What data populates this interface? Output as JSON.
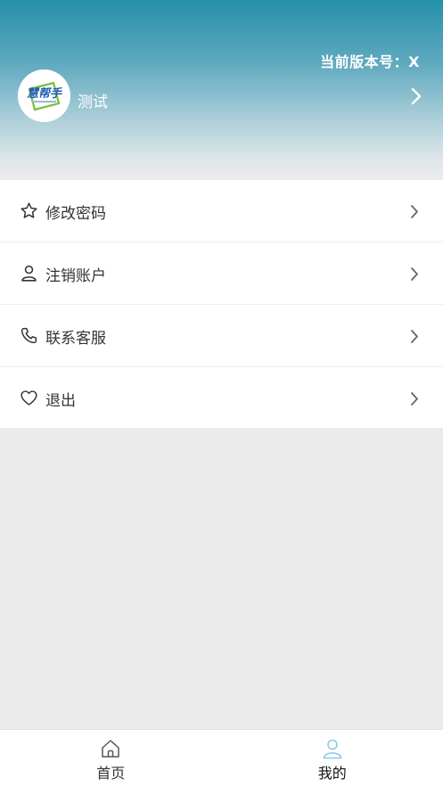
{
  "header": {
    "version_text": "当前版本号：X",
    "avatar_logo_text": "慧帮手",
    "username": "测试"
  },
  "menu": {
    "items": [
      {
        "label": "修改密码",
        "icon": "star-icon"
      },
      {
        "label": "注销账户",
        "icon": "user-icon"
      },
      {
        "label": "联系客服",
        "icon": "phone-icon"
      },
      {
        "label": "退出",
        "icon": "heart-icon"
      }
    ]
  },
  "tabbar": {
    "tabs": [
      {
        "label": "首页",
        "icon": "home-icon",
        "active": false
      },
      {
        "label": "我的",
        "icon": "user-icon",
        "active": true
      }
    ]
  },
  "colors": {
    "header_top": "#2590a9",
    "header_bottom": "#ececec",
    "active_tab_icon": "#8cc8ea",
    "text": "#333333",
    "background": "#ebebeb"
  }
}
